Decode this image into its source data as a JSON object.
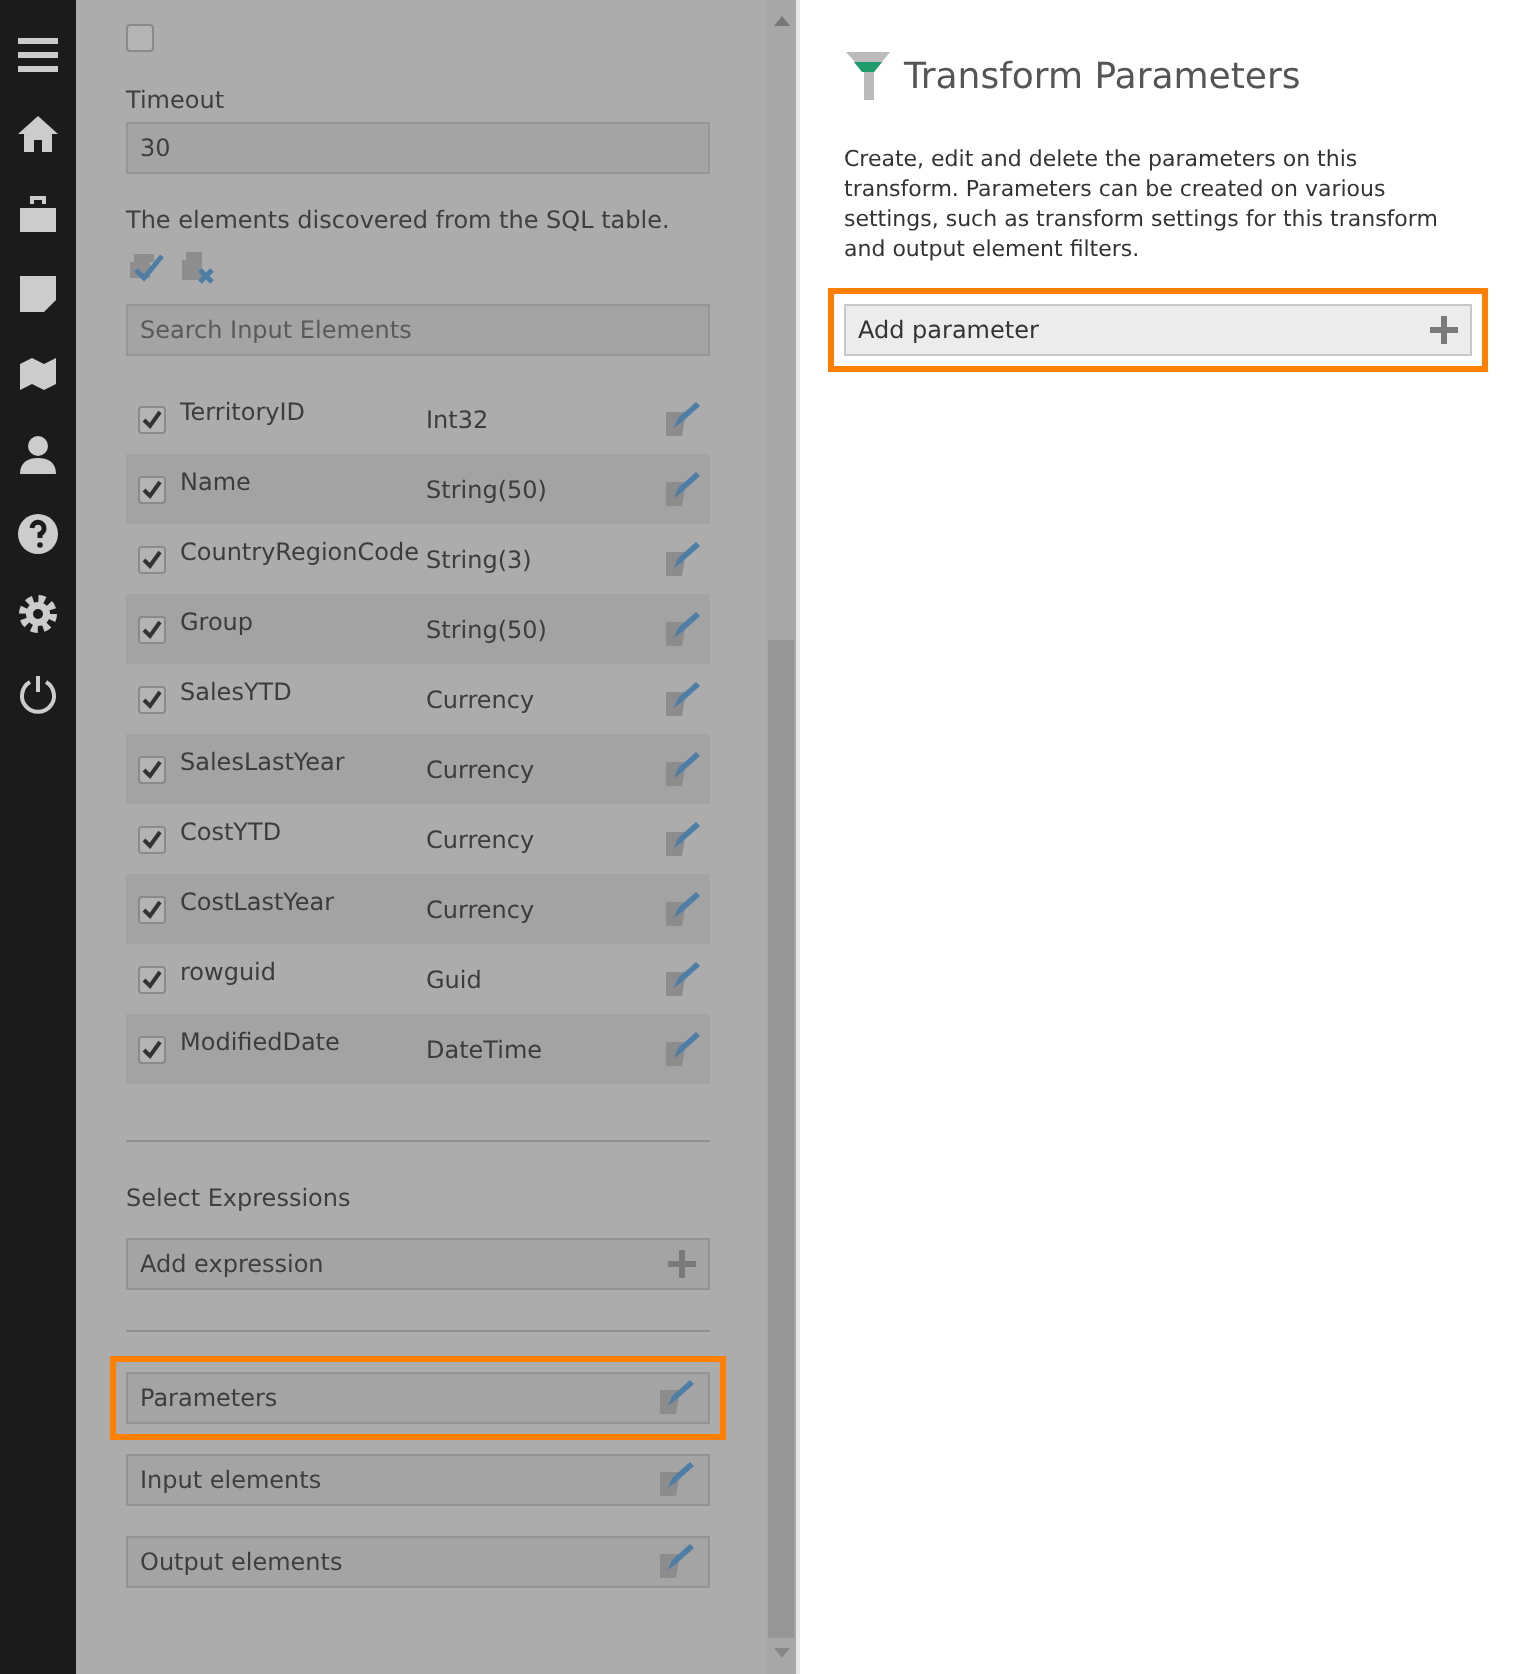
{
  "left_panel": {
    "counter_checkbox": {
      "checked": false
    },
    "timeout": {
      "label": "Timeout",
      "value": "30"
    },
    "description": "The elements discovered from the SQL table.",
    "search": {
      "placeholder": "Search Input Elements"
    },
    "elements": [
      {
        "name": "TerritoryID",
        "type": "Int32",
        "checked": true
      },
      {
        "name": "Name",
        "type": "String(50)",
        "checked": true
      },
      {
        "name": "CountryRegionCode",
        "type": "String(3)",
        "checked": true
      },
      {
        "name": "Group",
        "type": "String(50)",
        "checked": true
      },
      {
        "name": "SalesYTD",
        "type": "Currency",
        "checked": true
      },
      {
        "name": "SalesLastYear",
        "type": "Currency",
        "checked": true
      },
      {
        "name": "CostYTD",
        "type": "Currency",
        "checked": true
      },
      {
        "name": "CostLastYear",
        "type": "Currency",
        "checked": true
      },
      {
        "name": "rowguid",
        "type": "Guid",
        "checked": true
      },
      {
        "name": "ModifiedDate",
        "type": "DateTime",
        "checked": true
      }
    ],
    "expressions": {
      "label": "Select Expressions",
      "add_button": "Add expression"
    },
    "sections": [
      {
        "label": "Parameters",
        "highlighted": true
      },
      {
        "label": "Input elements",
        "highlighted": false
      },
      {
        "label": "Output elements",
        "highlighted": false
      }
    ]
  },
  "right_panel": {
    "title": "Transform Parameters",
    "description": "Create, edit and delete the parameters on this transform. Parameters can be created on various settings, such as transform settings for this transform and output element filters.",
    "add_button": {
      "label": "Add parameter",
      "highlighted": true
    }
  }
}
